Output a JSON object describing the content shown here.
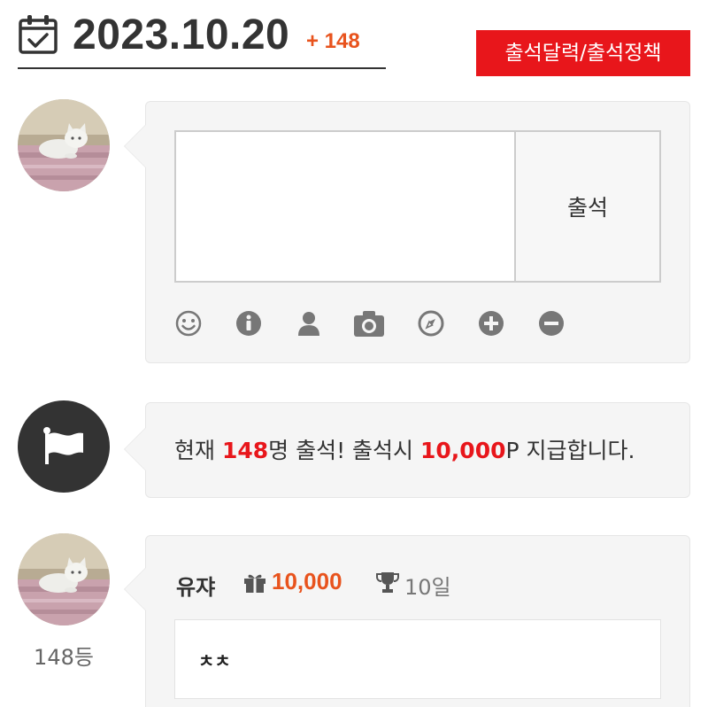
{
  "header": {
    "date": "2023.10.20",
    "count_delta": "+ 148",
    "policy_button": "출석달력/출석정책"
  },
  "checkin": {
    "button_label": "출석",
    "input_value": "",
    "tools": [
      "smiley-icon",
      "info-icon",
      "user-icon",
      "camera-icon",
      "compass-icon",
      "plus-circle-icon",
      "minus-circle-icon"
    ]
  },
  "info": {
    "prefix": "현재 ",
    "count": "148",
    "middle": "명 출석! 출석시 ",
    "points": "10,000",
    "suffix": "P 지급합니다."
  },
  "entry": {
    "name": "유쟈",
    "points": "10,000",
    "days": "10일",
    "text": "ㅊㅊ",
    "rank": "148등"
  },
  "colors": {
    "accent_red": "#e8161b",
    "accent_orange": "#e8531d",
    "bubble_bg": "#f5f5f5",
    "text": "#333333"
  }
}
